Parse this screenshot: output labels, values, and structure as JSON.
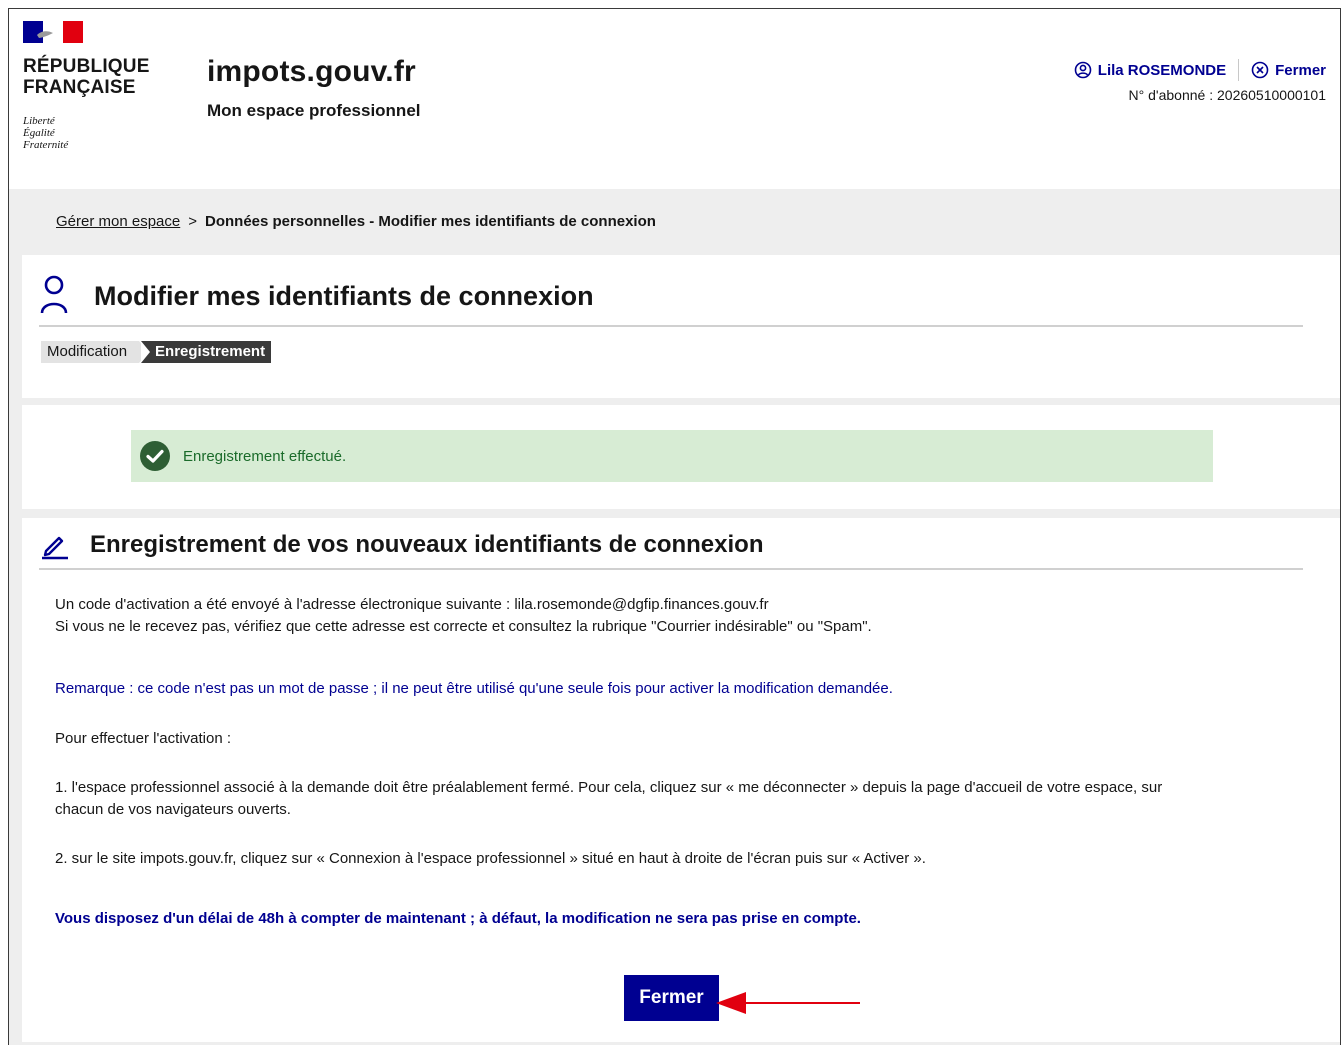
{
  "header": {
    "rf_title_line1": "RÉPUBLIQUE",
    "rf_title_line2": "FRANÇAISE",
    "motto_line1": "Liberté",
    "motto_line2": "Égalité",
    "motto_line3": "Fraternité",
    "site_name": "impots.gouv.fr",
    "site_subtitle": "Mon espace professionnel",
    "user_name": "Lila ROSEMONDE",
    "close_label": "Fermer",
    "abonne": "N° d'abonné : 20260510000101"
  },
  "breadcrumb": {
    "link": "Gérer mon espace",
    "separator": ">",
    "current": "Données personnelles - Modifier mes identifiants de connexion"
  },
  "page": {
    "title": "Modifier mes identifiants de connexion",
    "steps": [
      "Modification",
      "Enregistrement"
    ]
  },
  "alert": {
    "text": "Enregistrement effectué."
  },
  "section": {
    "title": "Enregistrement de vos nouveaux identifiants de connexion",
    "line1": "Un code d'activation a été envoyé à l'adresse électronique suivante : lila.rosemonde@dgfip.finances.gouv.fr",
    "line2": "Si vous ne le recevez pas, vérifiez que cette adresse est correcte et consultez la rubrique \"Courrier indésirable\" ou \"Spam\".",
    "remark": "Remarque : ce code n'est pas un mot de passe ; il ne peut être utilisé qu'une seule fois pour activer la modification demandée.",
    "intro": "Pour effectuer l'activation :",
    "step1_a": "1. l'espace professionnel associé à la demande doit être préalablement fermé. Pour cela, cliquez sur « me déconnecter » depuis la page d'accueil de votre espace, sur",
    "step1_b": "chacun de vos navigateurs ouverts.",
    "step2": "2. sur le site impots.gouv.fr, cliquez sur « Connexion à l'espace professionnel » situé en haut à droite de l'écran puis sur « Activer ».",
    "deadline": "Vous disposez d'un délai de 48h à compter de maintenant ; à défaut, la modification ne sera pas prise en compte.",
    "button": "Fermer"
  },
  "colors": {
    "brand_blue": "#000091",
    "success_bg": "#d7ecd4",
    "success_icon": "#18753c",
    "arrow": "#e1000f"
  }
}
